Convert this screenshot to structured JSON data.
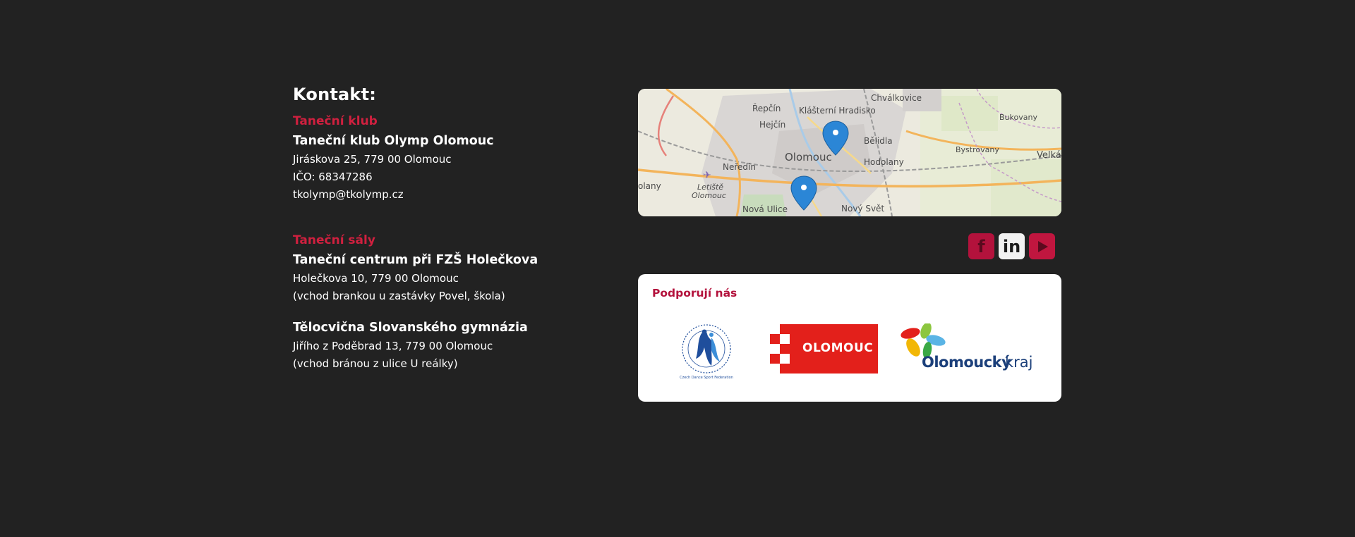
{
  "contact": {
    "heading": "Kontakt:",
    "club": {
      "label": "Taneční klub",
      "name": "Taneční klub Olymp Olomouc",
      "address": "Jiráskova 25, 779 00 Olomouc",
      "ico": "IČO: 68347286",
      "email": "tkolymp@tkolymp.cz"
    },
    "halls": {
      "label": "Taneční sály",
      "items": [
        {
          "name": "Taneční centrum při FZŠ Holečkova",
          "address": "Holečkova 10, 779 00 Olomouc",
          "note": "(vchod brankou u zastávky Povel, škola)"
        },
        {
          "name": "Tělocvična Slovanského gymnázia",
          "address": "Jiřího z Poděbrad 13, 779 00 Olomouc",
          "note": "(vchod bránou z ulice U reálky)"
        }
      ]
    }
  },
  "map": {
    "places": [
      "Řepčín",
      "Klášterní Hradisko",
      "Chválkovice",
      "Bukovany",
      "Hejčín",
      "Bělidla",
      "Bystrovany",
      "Velká",
      "Olomouc",
      "Hodolany",
      "Neředín",
      "olany",
      "Letiště",
      "Olomouc",
      "Nová Ulice",
      "Nový Svět"
    ],
    "markers": 2,
    "colors": {
      "marker": "#2b86d6",
      "road": "#f3b45b",
      "water": "#a9cbe8"
    }
  },
  "social": {
    "icons": [
      "facebook-icon",
      "linkedin-icon",
      "youtube-icon"
    ],
    "facebook_glyph": "f",
    "linkedin_glyph": "in"
  },
  "support": {
    "title": "Podporují nás",
    "logos": {
      "csts_caption": "Czech Dance Sport Federation",
      "olomouc": "OLOMOUC",
      "kraj_bold": "Olomoucký",
      "kraj_light": "kraj"
    }
  },
  "colors": {
    "background": "#222222",
    "accent": "#d0203f",
    "brand": "#b3123c"
  }
}
